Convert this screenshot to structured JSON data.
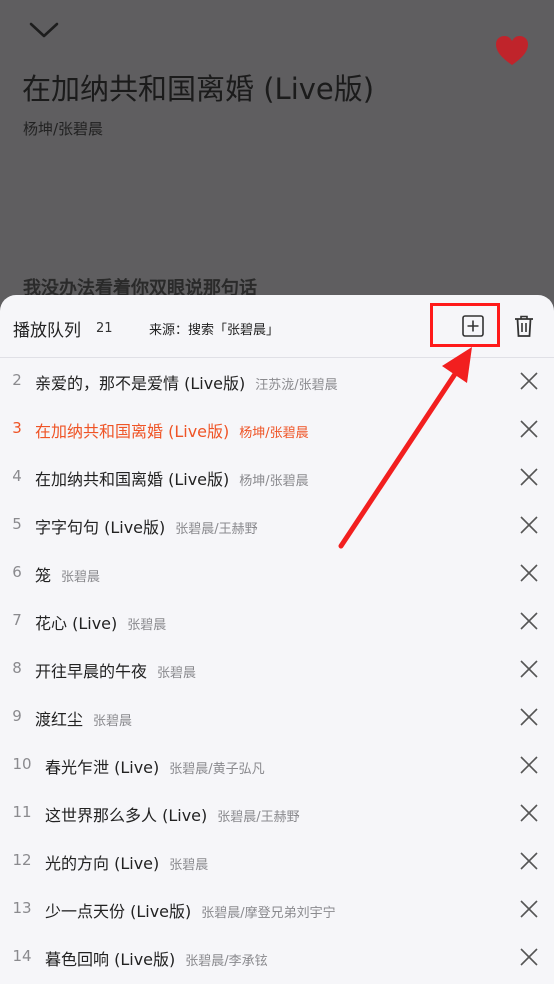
{
  "player": {
    "title": "在加纳共和国离婚 (Live版)",
    "artist": "杨坤/张碧晨",
    "lyric_line": "我没办法看着你双眼说那句话",
    "collapse_icon": "chevron-down-icon",
    "favorite_icon": "heart-icon",
    "favorite_color": "#c0242b"
  },
  "queue": {
    "title": "播放队列",
    "count": "21",
    "source": "来源：搜索「张碧晨」",
    "add_icon": "add-square-icon",
    "trash_icon": "trash-icon",
    "highlight_color": "#ff1a1a",
    "accent_color": "#ef5426",
    "items": [
      {
        "index": "2",
        "name": "亲爱的，那不是爱情 (Live版)",
        "artist": "汪苏泷/张碧晨"
      },
      {
        "index": "3",
        "name": "在加纳共和国离婚 (Live版)",
        "artist": "杨坤/张碧晨"
      },
      {
        "index": "4",
        "name": "在加纳共和国离婚 (Live版)",
        "artist": "杨坤/张碧晨"
      },
      {
        "index": "5",
        "name": "字字句句 (Live版)",
        "artist": "张碧晨/王赫野"
      },
      {
        "index": "6",
        "name": "笼",
        "artist": "张碧晨"
      },
      {
        "index": "7",
        "name": "花心 (Live)",
        "artist": "张碧晨"
      },
      {
        "index": "8",
        "name": "开往早晨的午夜",
        "artist": "张碧晨"
      },
      {
        "index": "9",
        "name": "渡红尘",
        "artist": "张碧晨"
      },
      {
        "index": "10",
        "name": "春光乍泄 (Live)",
        "artist": "张碧晨/黄子弘凡"
      },
      {
        "index": "11",
        "name": "这世界那么多人 (Live)",
        "artist": "张碧晨/王赫野"
      },
      {
        "index": "12",
        "name": "光的方向 (Live)",
        "artist": "张碧晨"
      },
      {
        "index": "13",
        "name": "少一点天份 (Live版)",
        "artist": "张碧晨/摩登兄弟刘宇宁"
      },
      {
        "index": "14",
        "name": "暮色回响 (Live版)",
        "artist": "张碧晨/李承铉"
      }
    ]
  }
}
